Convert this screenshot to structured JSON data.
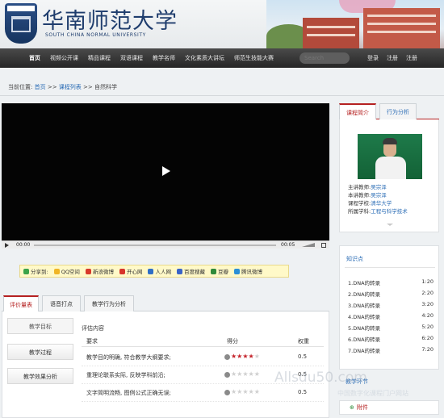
{
  "header": {
    "logo_cn": "华南师范大学",
    "logo_en": "SOUTH CHINA NORMAL UNIVERSITY"
  },
  "nav": {
    "items": [
      "首页",
      "视频公开课",
      "精品课程",
      "双语课程",
      "教学名师",
      "文化素质大讲坛",
      "师范生技能大赛"
    ],
    "search_placeholder": "Search",
    "right": [
      "登录",
      "注册",
      "注册"
    ]
  },
  "breadcrumb": {
    "prefix": "当前位置:",
    "home": "首页",
    "sep": ">>",
    "list": "课程列表",
    "current": "自然科学"
  },
  "player": {
    "current_time": "00:00",
    "total_time": "00:05"
  },
  "share": {
    "label": "分享到:",
    "items": [
      {
        "name": "QQ空间",
        "color": "#f0b526"
      },
      {
        "name": "新浪微博",
        "color": "#d83a2a"
      },
      {
        "name": "开心网",
        "color": "#d8342a"
      },
      {
        "name": "人人网",
        "color": "#2f6ec6"
      },
      {
        "name": "百度搜藏",
        "color": "#3a64c8"
      },
      {
        "name": "豆瓣",
        "color": "#2e8a3a"
      },
      {
        "name": "腾讯微博",
        "color": "#2b8fd6"
      }
    ]
  },
  "eval": {
    "tabs": [
      "评价量表",
      "语音打点",
      "教学行为分析"
    ],
    "side": [
      "教学目标",
      "教学过程",
      "教学效果分析"
    ],
    "table_title": "评估内容",
    "columns": [
      "要求",
      "得分",
      "权重"
    ],
    "rows": [
      {
        "req": "教学目的明确, 符合教学大纲要求;",
        "stars": 4,
        "weight": "0.5"
      },
      {
        "req": "重理论联系实际, 反映学科前沿;",
        "stars": 0,
        "weight": "0.5"
      },
      {
        "req": "文字简明流畅, 图例公式正确无误;",
        "stars": 0,
        "weight": "0.5"
      }
    ]
  },
  "right": {
    "tabs": [
      "课程简介",
      "行为分析"
    ],
    "info": [
      {
        "label": "主讲教师:",
        "value": "吴宗泽"
      },
      {
        "label": "本讲教师:",
        "value": "吴宗泽"
      },
      {
        "label": "课程学校:",
        "value": "清华大学"
      },
      {
        "label": "所属学科:",
        "value": "工程与科学技术"
      }
    ],
    "kp_title": "知识点",
    "kp": [
      {
        "title": "1.DNA的转录",
        "time": "1:20"
      },
      {
        "title": "2.DNA的转录",
        "time": "2:20"
      },
      {
        "title": "3.DNA的转录",
        "time": "3:20"
      },
      {
        "title": "4.DNA的转录",
        "time": "4:20"
      },
      {
        "title": "5.DNA的转录",
        "time": "5:20"
      },
      {
        "title": "6.DNA的转录",
        "time": "6:20"
      },
      {
        "title": "7.DNA的转录",
        "time": "7:20"
      }
    ],
    "lesson_title": "教学环节",
    "attach": "附件"
  },
  "watermark": {
    "main": "Allsdu50.com",
    "sub": "中国数字化课程门户网站"
  }
}
